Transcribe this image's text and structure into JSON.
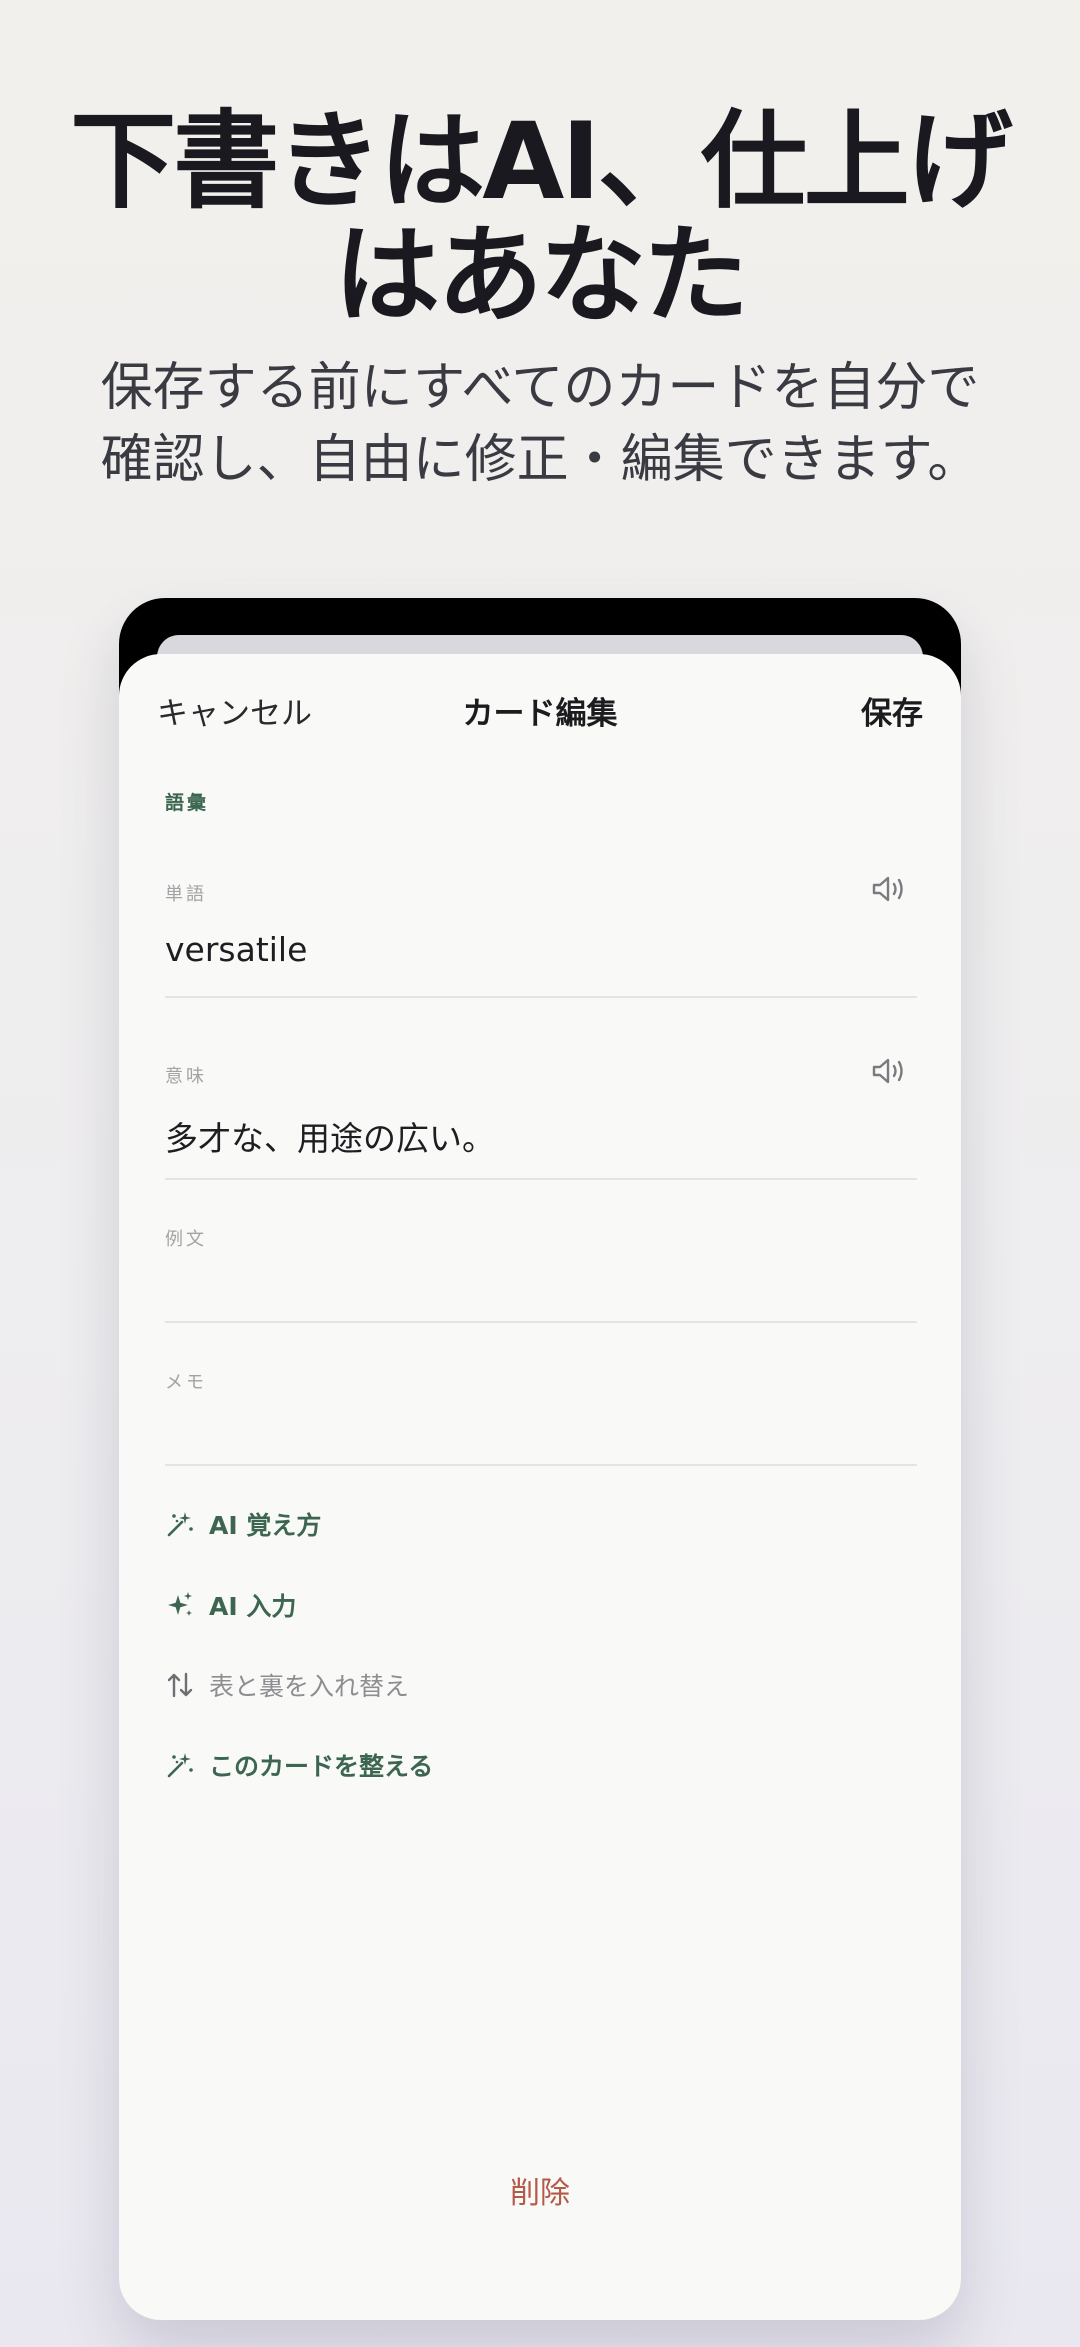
{
  "headline": {
    "line1": "下書きはAI、仕上げ",
    "line2": "はあなた"
  },
  "subline": {
    "line1": "保存する前にすべてのカードを自分で",
    "line2": "確認し、自由に修正・編集できます。"
  },
  "nav": {
    "cancel": "キャンセル",
    "title": "カード編集",
    "save": "保存"
  },
  "section": "語彙",
  "fields": {
    "word": {
      "label": "単語",
      "value": "versatile"
    },
    "meaning": {
      "label": "意味",
      "value": "多才な、用途の広い。"
    },
    "example": {
      "label": "例文",
      "value": ""
    },
    "memo": {
      "label": "メモ",
      "value": ""
    }
  },
  "actions": {
    "memorize": "AI 覚え方",
    "ai_input": "AI 入力",
    "swap": "表と裏を入れ替え",
    "tidy": "このカードを整える"
  },
  "delete": "削除",
  "colors": {
    "accent_green": "#3d6651",
    "delete_red": "#b45a48",
    "muted_gray": "#8e8e92"
  },
  "icons": [
    "speaker-icon",
    "magic-wand-icon",
    "sparkles-icon",
    "swap-arrows-icon"
  ]
}
